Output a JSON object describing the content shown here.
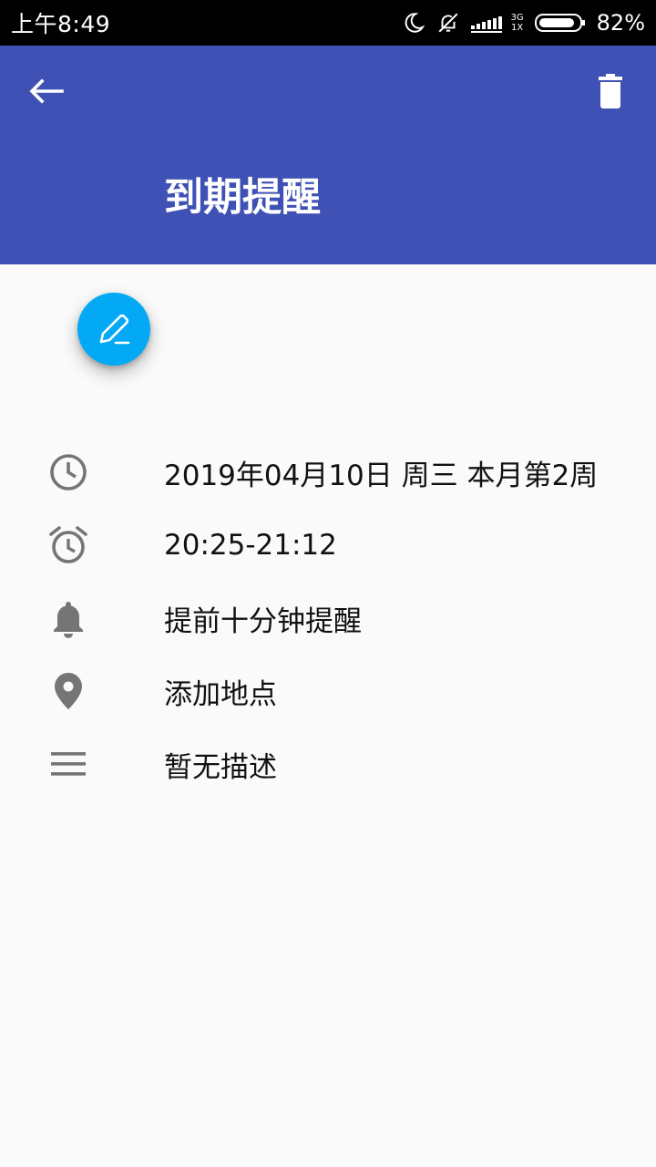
{
  "status_bar": {
    "time": "上午8:49",
    "network_top": "3G",
    "network_bottom": "1X",
    "battery_percent": "82%"
  },
  "app_bar": {
    "title": "到期提醒",
    "color": "#3f51b5"
  },
  "fab": {
    "color": "#03a9f4",
    "icon": "pencil-icon"
  },
  "details": {
    "date": "2019年04月10日  周三  本月第2周",
    "time_range": "20:25-21:12",
    "reminder": "提前十分钟提醒",
    "location": "添加地点",
    "description": "暂无描述"
  }
}
